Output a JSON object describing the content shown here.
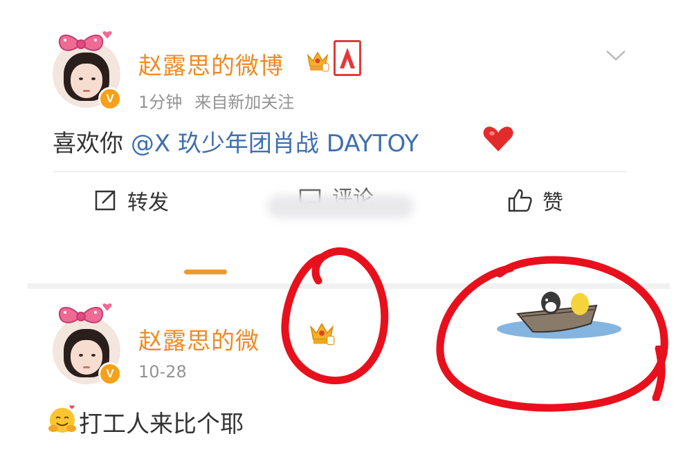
{
  "post": {
    "username": "赵露思的微博",
    "time": "1分钟",
    "source": "来自新加关注",
    "content_prefix": "喜欢你 ",
    "mention": "@X 玖少年团肖战 DAYTOY",
    "emoji": "heart-emoji"
  },
  "actions": {
    "repost_label": "转发",
    "comment_label": "评论",
    "like_label": "赞"
  },
  "post2": {
    "username": "赵露思的微",
    "time": "10-28",
    "content": "打工人来比个耶"
  },
  "colors": {
    "username": "#f08a24",
    "mention": "#3e6fb0",
    "annotation_red": "#e8101c",
    "verified": "#f7a01a",
    "tab_indicator": "#f09a2a"
  }
}
